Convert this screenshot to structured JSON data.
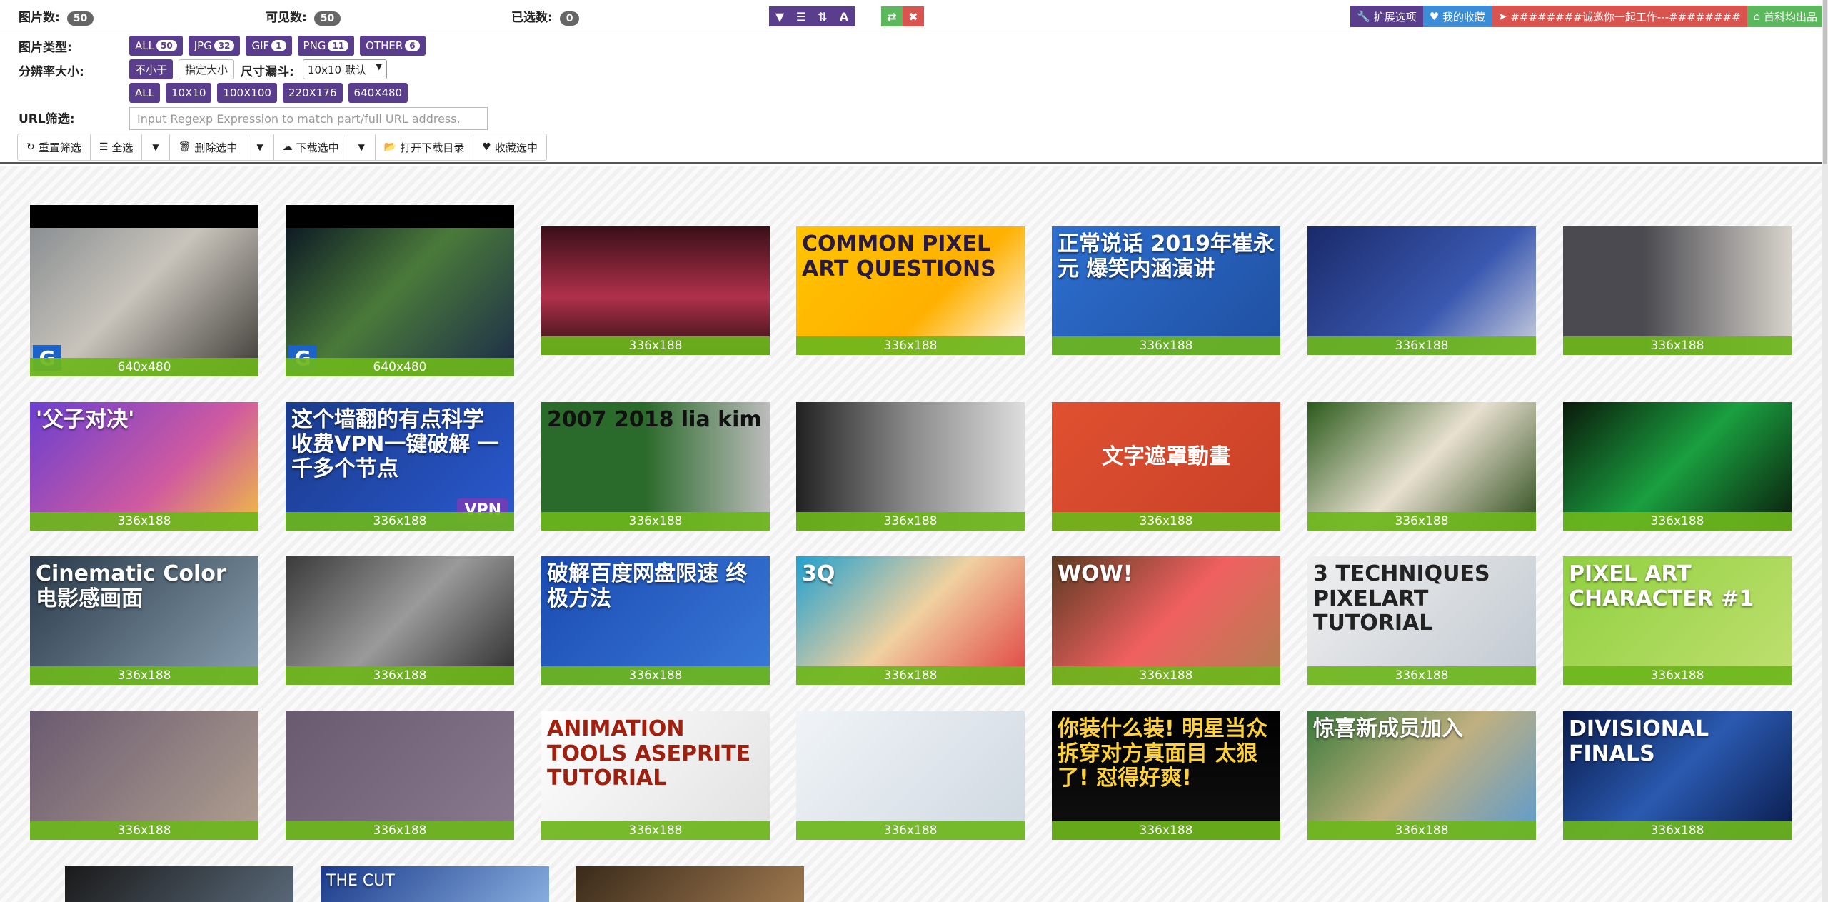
{
  "stats": {
    "total_label": "图片数:",
    "total": "50",
    "visible_label": "可见数:",
    "visible": "50",
    "selected_label": "已选数:",
    "selected": "0"
  },
  "toolbar_icons": [
    "filter-icon",
    "list-icon",
    "sort-icon",
    "text-icon"
  ],
  "swap_icons": [
    "swap-icon",
    "close-icon"
  ],
  "ext_links": [
    {
      "label": "扩展选项",
      "color": "#5b3d8e",
      "icon": "wrench-icon"
    },
    {
      "label": "我的收藏",
      "color": "#3c8dd8",
      "icon": "heart-icon"
    },
    {
      "label": "########诚邀你一起工作---########",
      "color": "#d9534f",
      "icon": "send-icon"
    },
    {
      "label": "首科均出品",
      "color": "#5cb85c",
      "icon": "home-icon"
    }
  ],
  "filters": {
    "type_label": "图片类型:",
    "types": [
      {
        "label": "ALL",
        "count": "50"
      },
      {
        "label": "JPG",
        "count": "32"
      },
      {
        "label": "GIF",
        "count": "1"
      },
      {
        "label": "PNG",
        "count": "11"
      },
      {
        "label": "OTHER",
        "count": "6"
      }
    ],
    "resolution_label": "分辨率大小:",
    "res_modes": [
      "不小于",
      "指定大小"
    ],
    "funnel_label": "尺寸漏斗:",
    "funnel_value": "10x10 默认",
    "sizes": [
      "ALL",
      "10X10",
      "100X100",
      "220X176",
      "640X480"
    ],
    "url_label": "URL筛选:",
    "url_placeholder": "Input Regexp Expression to match part/full URL address."
  },
  "actions": [
    {
      "label": "重置筛选",
      "icon": "refresh-icon"
    },
    {
      "label": "全选",
      "icon": "list-icon"
    },
    {
      "label": "删除选中",
      "icon": "trash-icon"
    },
    {
      "label": "下载选中",
      "icon": "download-icon"
    },
    {
      "label": "打开下载目录",
      "icon": "folder-icon"
    },
    {
      "label": "收藏选中",
      "icon": "heart-icon"
    }
  ],
  "thumbnails": [
    {
      "size": "640x480",
      "overlay": ""
    },
    {
      "size": "640x480",
      "overlay": ""
    },
    {
      "size": "336x188",
      "overlay": ""
    },
    {
      "size": "336x188",
      "overlay": "COMMON PIXEL ART QUESTIONS"
    },
    {
      "size": "336x188",
      "overlay": "正常说话 2019年崔永元 爆笑内涵演讲"
    },
    {
      "size": "336x188",
      "overlay": ""
    },
    {
      "size": "336x188",
      "overlay": ""
    },
    {
      "size": "336x188",
      "overlay": "'父子对决'"
    },
    {
      "size": "336x188",
      "overlay": "这个墙翻的有点科学 收费VPN一键破解 一千多个节点"
    },
    {
      "size": "336x188",
      "overlay": "2007 2018 lia kim"
    },
    {
      "size": "336x188",
      "overlay": ""
    },
    {
      "size": "336x188",
      "overlay": "文字遮罩動畫"
    },
    {
      "size": "336x188",
      "overlay": ""
    },
    {
      "size": "336x188",
      "overlay": ""
    },
    {
      "size": "336x188",
      "overlay": "Cinematic Color 电影感画面"
    },
    {
      "size": "336x188",
      "overlay": ""
    },
    {
      "size": "336x188",
      "overlay": "破解百度网盘限速 终极方法"
    },
    {
      "size": "336x188",
      "overlay": "3Q"
    },
    {
      "size": "336x188",
      "overlay": "WOW!"
    },
    {
      "size": "336x188",
      "overlay": "3 TECHNIQUES PIXELART TUTORIAL"
    },
    {
      "size": "336x188",
      "overlay": "PIXEL ART CHARACTER #1"
    },
    {
      "size": "336x188",
      "overlay": ""
    },
    {
      "size": "336x188",
      "overlay": ""
    },
    {
      "size": "336x188",
      "overlay": "ANIMATION TOOLS ASEPRITE TUTORIAL"
    },
    {
      "size": "336x188",
      "overlay": ""
    },
    {
      "size": "336x188",
      "overlay": "你装什么装! 明星当众拆穿对方真面目 太狠了! 怼得好爽!"
    },
    {
      "size": "336x188",
      "overlay": "惊喜新成员加入"
    },
    {
      "size": "336x188",
      "overlay": "DIVISIONAL FINALS"
    }
  ],
  "bottom_row": [
    {
      "overlay": ""
    },
    {
      "overlay": "THE CUT"
    },
    {
      "overlay": ""
    }
  ]
}
